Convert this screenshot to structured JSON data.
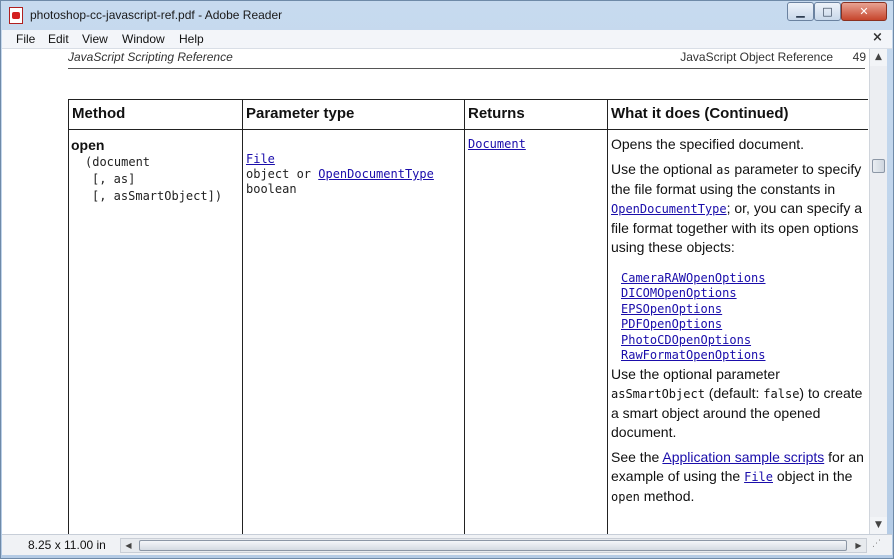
{
  "window": {
    "title": "photoshop-cc-javascript-ref.pdf - Adobe Reader",
    "buttons": {
      "minimize": "▁",
      "maximize": "□",
      "close": "✕"
    }
  },
  "menu": {
    "items": [
      "File",
      "Edit",
      "View",
      "Window",
      "Help"
    ],
    "close_doc": "×"
  },
  "running_head": {
    "left": "JavaScript Scripting Reference",
    "right": "JavaScript Object Reference",
    "page": "49"
  },
  "table": {
    "headers": [
      "Method",
      "Parameter type",
      "Returns",
      "What it does (Continued)"
    ],
    "row": {
      "method_name": "open",
      "signature": [
        "(document",
        "[, as]",
        "[, asSmartObject])"
      ],
      "param_types": {
        "p1_link": "File",
        "p2_text": "object or ",
        "p2_link": "OpenDocumentType",
        "p3_text": "boolean"
      },
      "returns_link": "Document",
      "desc": {
        "p1": "Opens the specified document.",
        "p2_a": "Use the optional ",
        "p2_code": "as",
        "p2_b": " parameter to specify the file format using the constants in ",
        "p2_link": "OpenDocumentType",
        "p2_c": "; or, you can specify a file format together with its open options using these objects:",
        "options": [
          "CameraRAWOpenOptions",
          "DICOMOpenOptions",
          "EPSOpenOptions",
          "PDFOpenOptions",
          "PhotoCDOpenOptions",
          "RawFormatOpenOptions"
        ],
        "p3_a": "Use the optional parameter ",
        "p3_code1": "asSmartObject",
        "p3_b": " (default: ",
        "p3_code2": "false",
        "p3_c": ") to create a smart object around the opened document.",
        "p4_a": "See the ",
        "p4_link": "Application sample scripts",
        "p4_b": " for an example of using the ",
        "p4_code_link": "File",
        "p4_c": " object in the ",
        "p4_code": "open",
        "p4_d": " method."
      }
    }
  },
  "status": {
    "page_size": "8.25 x 11.00 in"
  }
}
